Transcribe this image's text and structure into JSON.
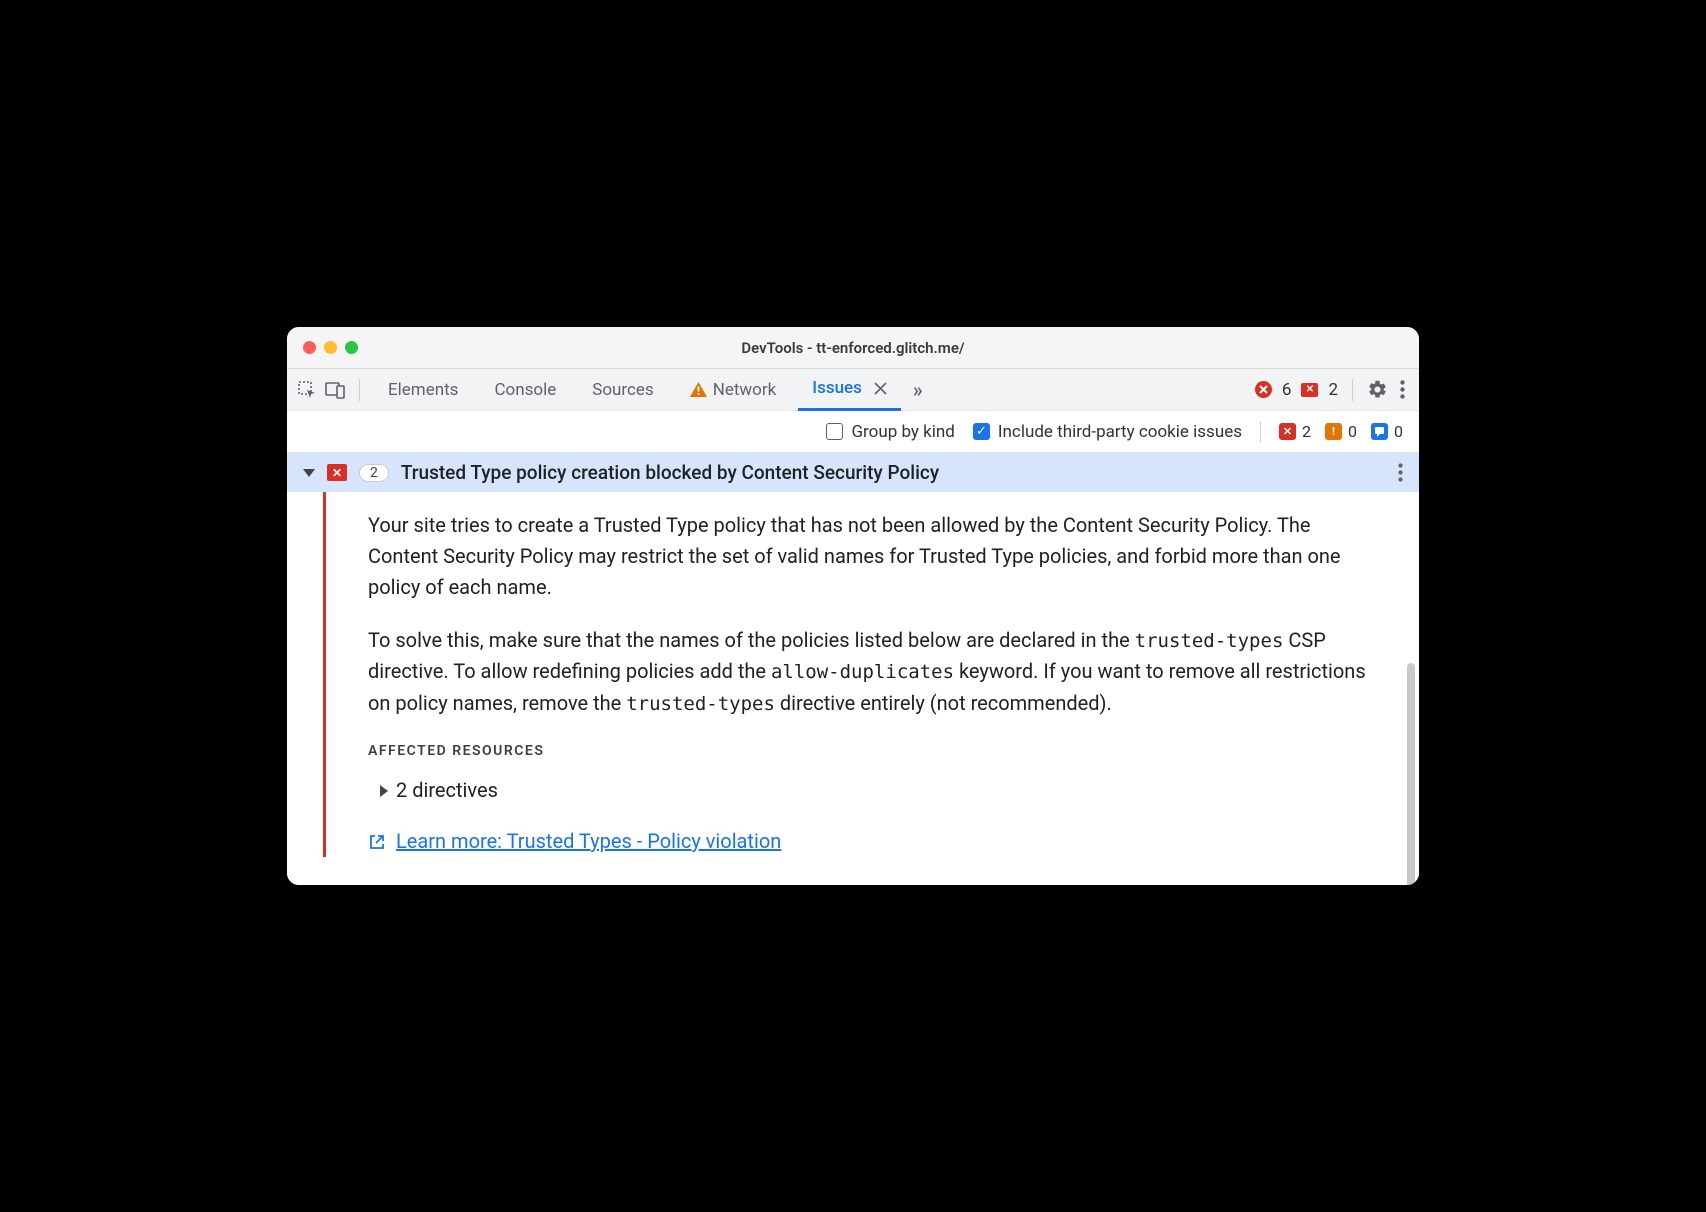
{
  "window": {
    "title": "DevTools - tt-enforced.glitch.me/"
  },
  "tabs": {
    "items": [
      "Elements",
      "Console",
      "Sources",
      "Network",
      "Issues"
    ],
    "active": "Issues",
    "network_warning": true,
    "overflow_glyph": "»"
  },
  "top_counts": {
    "errors": "6",
    "violations": "2"
  },
  "filters": {
    "group_by_kind": {
      "label": "Group by kind",
      "checked": false
    },
    "third_party": {
      "label": "Include third-party cookie issues",
      "checked": true
    },
    "red_count": "2",
    "orange_count": "0",
    "blue_count": "0"
  },
  "issue": {
    "count": "2",
    "title": "Trusted Type policy creation blocked by Content Security Policy",
    "p1": "Your site tries to create a Trusted Type policy that has not been allowed by the Content Security Policy. The Content Security Policy may restrict the set of valid names for Trusted Type policies, and forbid more than one policy of each name.",
    "p2a": "To solve this, make sure that the names of the policies listed below are declared in the ",
    "code1": "trusted-types",
    "p2b": " CSP directive. To allow redefining policies add the ",
    "code2": "allow-duplicates",
    "p2c": " keyword. If you want to remove all restrictions on policy names, remove the ",
    "code3": "trusted-types",
    "p2d": " directive entirely (not recommended).",
    "affected_heading": "AFFECTED RESOURCES",
    "directives_label": "2 directives",
    "learn_more": "Learn more: Trusted Types - Policy violation"
  }
}
